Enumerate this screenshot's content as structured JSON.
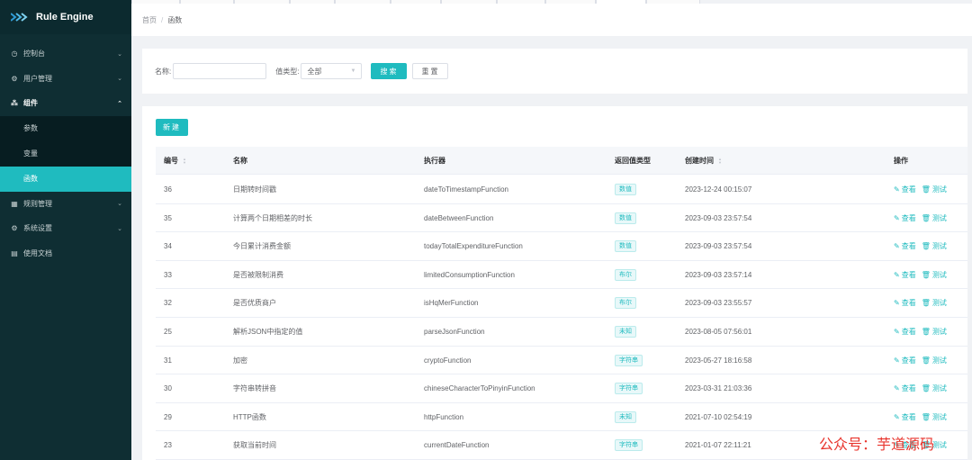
{
  "app": {
    "title": "Rule Engine"
  },
  "sidebar": {
    "items": [
      {
        "label": "控制台",
        "icon": "dashboard-icon",
        "glyph": "◷",
        "chevron": "⌄"
      },
      {
        "label": "用户管理",
        "icon": "gear-icon",
        "glyph": "⚙",
        "chevron": "⌄"
      },
      {
        "label": "组件",
        "icon": "components-icon",
        "glyph": "⁂",
        "chevron": "⌃"
      },
      {
        "label": "规则管理",
        "icon": "grid-icon",
        "glyph": "▦",
        "chevron": "⌄"
      },
      {
        "label": "系统设置",
        "icon": "settings-icon",
        "glyph": "⚙",
        "chevron": "⌄"
      },
      {
        "label": "使用文档",
        "icon": "document-icon",
        "glyph": "▤"
      }
    ],
    "sub_items": [
      {
        "label": "参数"
      },
      {
        "label": "变量"
      },
      {
        "label": "函数"
      }
    ]
  },
  "breadcrumb": {
    "home": "首页",
    "separator": "/",
    "current": "函数"
  },
  "search": {
    "name_label": "名称:",
    "name_value": "",
    "type_label": "值类型:",
    "type_value": "全部",
    "search_button": "搜索",
    "reset_button": "重置"
  },
  "toolbar": {
    "new_button": "新建"
  },
  "table": {
    "columns": {
      "id": "编号",
      "name": "名称",
      "executor": "执行器",
      "return_type": "返回值类型",
      "created": "创建时间",
      "actions": "操作"
    },
    "action_view": "查看",
    "action_test": "测试",
    "rows": [
      {
        "id": "36",
        "name": "日期转时间戳",
        "executor": "dateToTimestampFunction",
        "type": "数值",
        "created": "2023-12-24 00:15:07"
      },
      {
        "id": "35",
        "name": "计算两个日期相差的时长",
        "executor": "dateBetweenFunction",
        "type": "数值",
        "created": "2023-09-03 23:57:54"
      },
      {
        "id": "34",
        "name": "今日累计消费金额",
        "executor": "todayTotalExpenditureFunction",
        "type": "数值",
        "created": "2023-09-03 23:57:54"
      },
      {
        "id": "33",
        "name": "是否被限制消费",
        "executor": "limitedConsumptionFunction",
        "type": "布尔",
        "created": "2023-09-03 23:57:14"
      },
      {
        "id": "32",
        "name": "是否优质商户",
        "executor": "isHqMerFunction",
        "type": "布尔",
        "created": "2023-09-03 23:55:57"
      },
      {
        "id": "25",
        "name": "解析JSON中指定的值",
        "executor": "parseJsonFunction",
        "type": "未知",
        "created": "2023-08-05 07:56:01"
      },
      {
        "id": "31",
        "name": "加密",
        "executor": "cryptoFunction",
        "type": "字符串",
        "created": "2023-05-27 18:16:58"
      },
      {
        "id": "30",
        "name": "字符串转拼音",
        "executor": "chineseCharacterToPinyinFunction",
        "type": "字符串",
        "created": "2023-03-31 21:03:36"
      },
      {
        "id": "29",
        "name": "HTTP函数",
        "executor": "httpFunction",
        "type": "未知",
        "created": "2021-07-10 02:54:19"
      },
      {
        "id": "23",
        "name": "获取当前时间",
        "executor": "currentDateFunction",
        "type": "字符串",
        "created": "2021-01-07 22:11:21"
      }
    ]
  },
  "watermark": "公众号：芋道源码",
  "colors": {
    "accent": "#1fbbbf",
    "sidebar_bg": "#0f2e33",
    "watermark": "#e8342c"
  }
}
